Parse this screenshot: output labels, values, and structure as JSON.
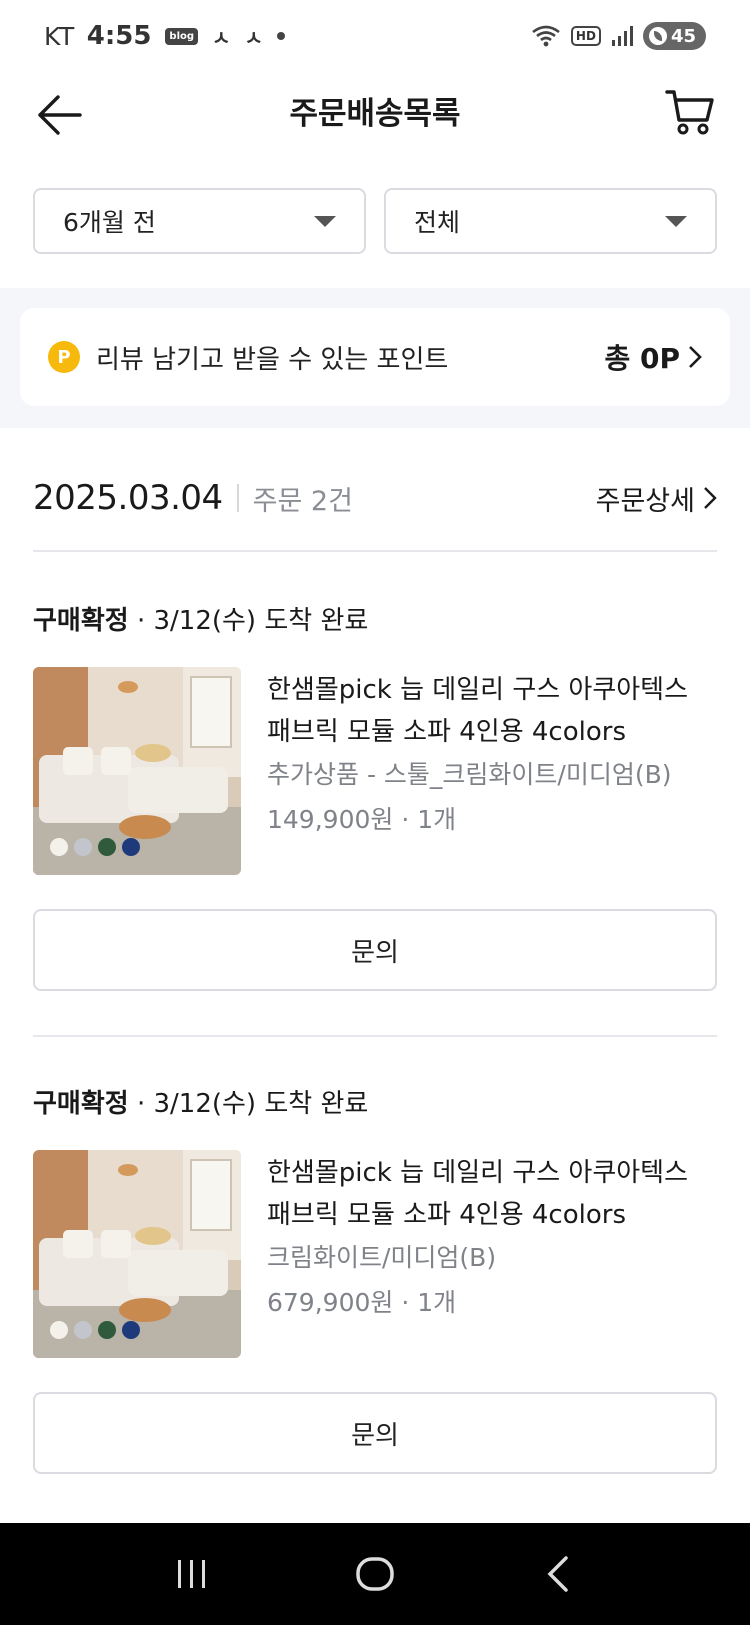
{
  "status_bar": {
    "carrier": "KT",
    "time": "4:55",
    "blog_badge": "blog",
    "app_glyph_1": "ㅅ",
    "app_glyph_2": "ㅅ",
    "battery": "45"
  },
  "header": {
    "title": "주문배송목록"
  },
  "filters": {
    "period": "6개월 전",
    "status": "전체"
  },
  "points": {
    "icon_letter": "P",
    "label": "리뷰 남기고 받을 수 있는 포인트",
    "total": "총 0P"
  },
  "order": {
    "date": "2025.03.04",
    "count": "주문 2건",
    "detail_label": "주문상세"
  },
  "items": [
    {
      "status_bold": "구매확정",
      "status_rest": " · 3/12(수) 도착 완료",
      "name_line1": "한샘몰pick 늡 데일리 구스 아쿠아텍스",
      "name_line2": "패브릭 모듈 소파 4인용 4colors",
      "option": "추가상품 - 스툴_크림화이트/미디엄(B)",
      "price": "149,900원 · 1개",
      "button": "문의"
    },
    {
      "status_bold": "구매확정",
      "status_rest": " · 3/12(수) 도착 완료",
      "name_line1": "한샘몰pick 늡 데일리 구스 아쿠아텍스",
      "name_line2": "패브릭 모듈 소파 4인용 4colors",
      "option": "크림화이트/미디엄(B)",
      "price": "679,900원 · 1개",
      "button": "문의"
    }
  ],
  "colors": {
    "accent_point": "#f6b90c",
    "border": "#d9dbe0",
    "muted_text": "#7f8389",
    "band_bg": "#f4f6f9"
  }
}
